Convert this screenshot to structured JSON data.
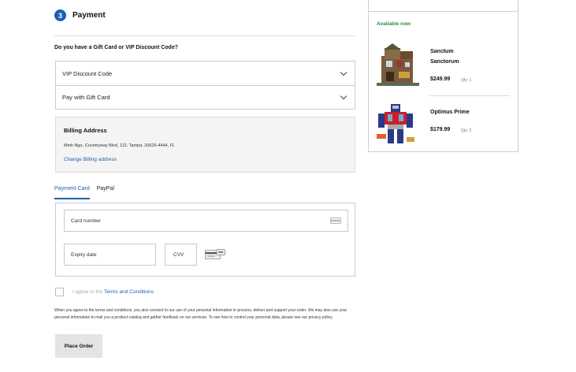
{
  "checkout": {
    "step_number": "3",
    "step_title": "Payment",
    "gift_question": "Do you have a Gift Card or VIP Discount Code?",
    "accordion": [
      {
        "label": "VIP Discount Code"
      },
      {
        "label": "Pay with Gift Card"
      }
    ],
    "billing": {
      "title": "Billing Address",
      "address": "Minh Ngo, Countryway Blvd, 112, Tampa, 33626-4444, FL",
      "change_link": "Change Billing address"
    },
    "payment_tabs": [
      {
        "label": "Payment Card",
        "active": true
      },
      {
        "label": "PayPal",
        "active": false
      }
    ],
    "card_form": {
      "card_number_label": "Card number",
      "expiry_label": "Expiry date",
      "cvv_label": "CVV"
    },
    "terms": {
      "prefix": "I agree to the ",
      "link": "Terms and Conditions"
    },
    "consent_text": "When you agree to the terms and conditions, you also consent to our use of your personal information to process, deliver and support your order. We may also use your personal information to mail you a product catalog and gather feedback on our services. To see how to control your personal data, please see our privacy policy.",
    "place_order_label": "Place Order"
  },
  "summary": {
    "availability": "Available now",
    "items": [
      {
        "name": "Sanctum Sanctorum",
        "price": "$249.99",
        "qty": "Qty: 1"
      },
      {
        "name": "Optimus Prime",
        "price": "$179.99",
        "qty": "Qty: 2"
      }
    ]
  },
  "colors": {
    "accent_blue": "#1d5fb1",
    "available_green": "#2f8a3a",
    "button_gray": "#e4e4e4",
    "billing_bg": "#f4f4f4"
  }
}
